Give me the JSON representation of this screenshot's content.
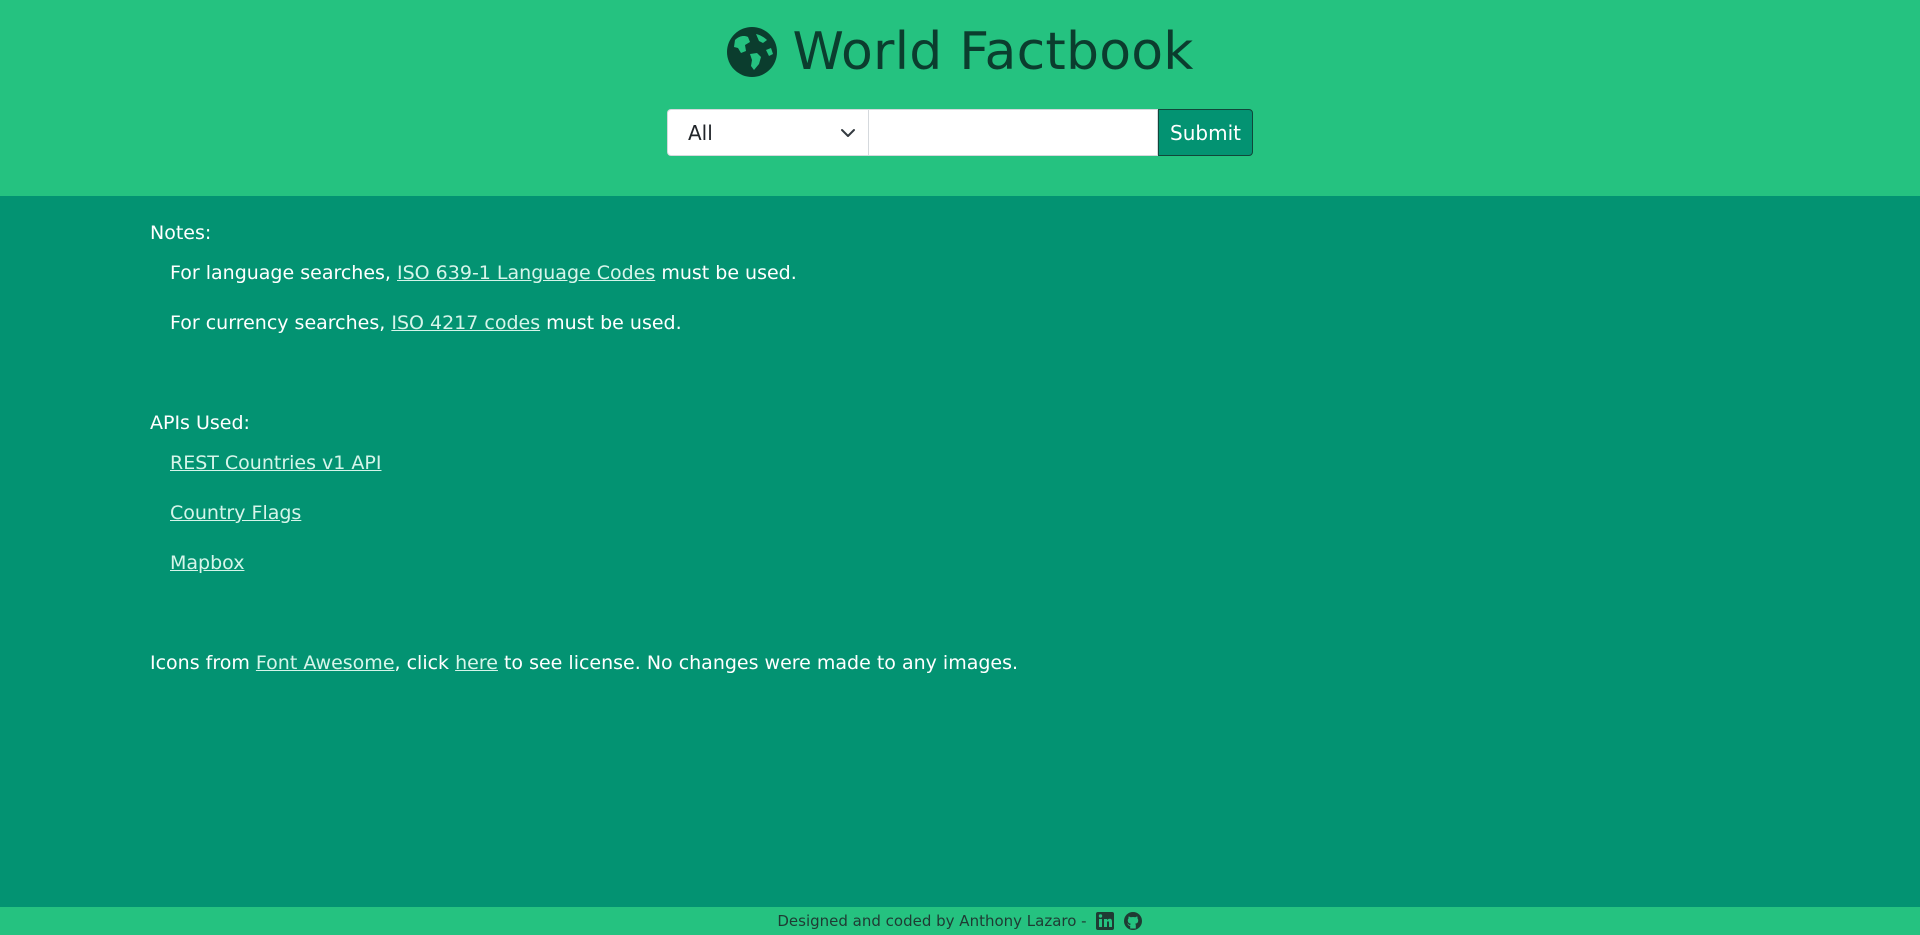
{
  "header": {
    "title": "World Factbook",
    "logo_icon": "globe-americas-icon"
  },
  "search": {
    "selected_option": "All",
    "input_value": "",
    "input_placeholder": "",
    "submit_label": "Submit"
  },
  "notes": {
    "heading": "Notes:",
    "language_prefix": "For language searches,",
    "language_link": "ISO 639-1 Language Codes",
    "language_suffix": "must be used.",
    "currency_prefix": "For currency searches,",
    "currency_link": "ISO 4217 codes",
    "currency_suffix": "must be used."
  },
  "apis": {
    "heading": "APIs Used:",
    "links": [
      "REST Countries v1 API",
      "Country Flags",
      "Mapbox"
    ]
  },
  "icons_credit": {
    "prefix": "Icons from",
    "font_awesome_link": "Font Awesome",
    "middle": ", click",
    "here_link": "here",
    "suffix": "to see license. No changes were made to any images."
  },
  "footer": {
    "credit": "Designed and coded by Anthony Lazaro -",
    "icons": [
      "linkedin-icon",
      "github-icon"
    ]
  },
  "colors": {
    "header_bg": "#25c280",
    "body_bg": "#039372",
    "title_text": "#0b3d2e"
  }
}
